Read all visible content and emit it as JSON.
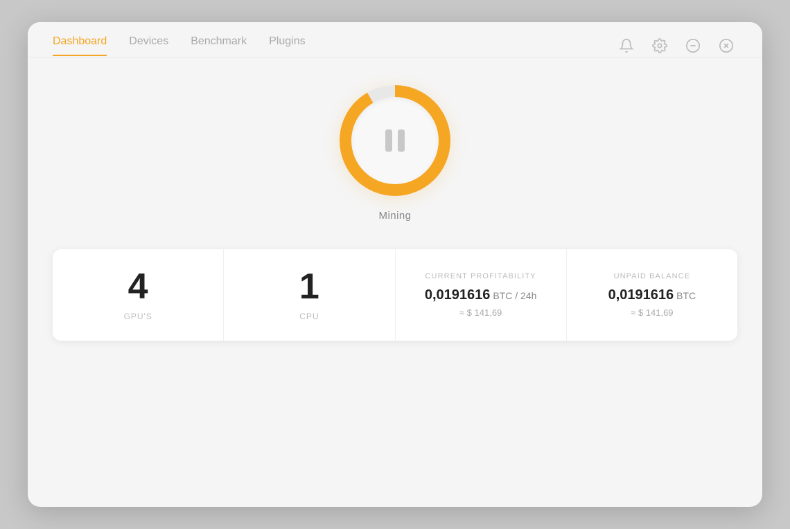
{
  "nav": {
    "items": [
      {
        "label": "Dashboard",
        "active": true
      },
      {
        "label": "Devices",
        "active": false
      },
      {
        "label": "Benchmark",
        "active": false
      },
      {
        "label": "Plugins",
        "active": false
      }
    ]
  },
  "icons": {
    "bell": "bell-icon",
    "gear": "gear-icon",
    "minus": "minimize-icon",
    "close": "close-icon"
  },
  "mining": {
    "status_label": "Mining"
  },
  "stats": [
    {
      "value": "4",
      "label": "GPU'S"
    },
    {
      "value": "1",
      "label": "CPU"
    },
    {
      "section_label": "CURRENT PROFITABILITY",
      "btc_value": "0,0191616",
      "btc_unit": "BTC / 24h",
      "approx": "≈ $ 141,69"
    },
    {
      "section_label": "UNPAID BALANCE",
      "btc_value": "0,0191616",
      "btc_unit": "BTC",
      "approx": "≈ $ 141,69"
    }
  ]
}
